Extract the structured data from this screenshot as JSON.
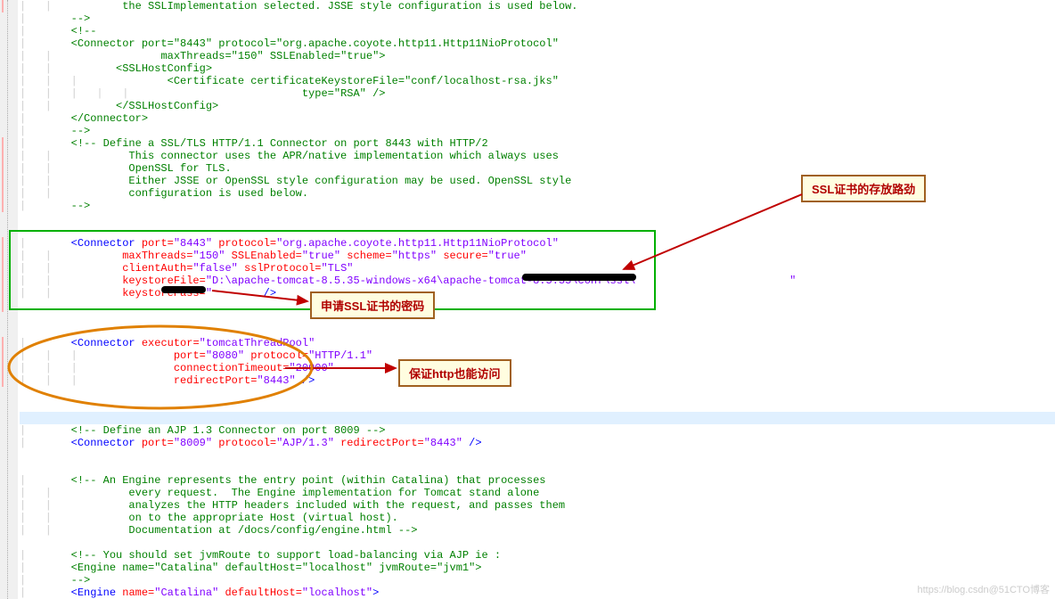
{
  "annotations": {
    "ssl_path": "SSL证书的存放路劲",
    "ssl_password": "申请SSL证书的密码",
    "http_access": "保证http也能访问"
  },
  "code": {
    "l0": "        the SSLImplementation selected. JSSE style configuration is used below.",
    "l1": "    -->",
    "l2": "    <!--",
    "l3": "    <Connector port=\"8443\" protocol=\"org.apache.coyote.http11.Http11NioProtocol\"",
    "l4": "               maxThreads=\"150\" SSLEnabled=\"true\">",
    "l5": "        <SSLHostConfig>",
    "l6": "            <Certificate certificateKeystoreFile=\"conf/localhost-rsa.jks\"",
    "l7": "                         type=\"RSA\" />",
    "l8": "        </SSLHostConfig>",
    "l9": "    </Connector>",
    "l10": "    -->",
    "l11": "    <!-- Define a SSL/TLS HTTP/1.1 Connector on port 8443 with HTTP/2",
    "l12": "         This connector uses the APR/native implementation which always uses",
    "l13": "         OpenSSL for TLS.",
    "l14": "         Either JSSE or OpenSSL style configuration may be used. OpenSSL style",
    "l15": "         configuration is used below.",
    "l16": "    -->",
    "c1_open": "<Connector",
    "c1_port_k": " port=",
    "c1_port_v": "\"8443\"",
    "c1_proto_k": " protocol=",
    "c1_proto_v": "\"org.apache.coyote.http11.Http11NioProtocol\"",
    "c1_mt_k": "maxThreads=",
    "c1_mt_v": "\"150\"",
    "c1_ssl_k": " SSLEnabled=",
    "c1_ssl_v": "\"true\"",
    "c1_sch_k": " scheme=",
    "c1_sch_v": "\"https\"",
    "c1_sec_k": " secure=",
    "c1_sec_v": "\"true\"",
    "c1_ca_k": "clientAuth=",
    "c1_ca_v": "\"false\"",
    "c1_sp_k": " sslProtocol=",
    "c1_sp_v": "\"TLS\"",
    "c1_kf_k": "keystoreFile=",
    "c1_kf_v": "\"D:\\apache-tomcat-8.5.35-windows-x64\\apache-tomcat-8.5.35\\conf\\ssl\\",
    "c1_kf_end": "\"",
    "c1_kp_k": "keystorePass=",
    "c1_kp_v": "\"",
    "c1_close": "/>",
    "c2_open": "<Connector",
    "c2_ex_k": " executor=",
    "c2_ex_v": "\"tomcatThreadPool\"",
    "c2_port_k": "port=",
    "c2_port_v": "\"8080\"",
    "c2_proto_k": " protocol=",
    "c2_proto_v": "\"HTTP/1.1\"",
    "c2_ct_k": "connectionTimeout=",
    "c2_ct_v": "\"20000\"",
    "c2_rp_k": "redirectPort=",
    "c2_rp_v": "\"8443\"",
    "c2_close": " />",
    "l30": "    <!-- Define an AJP 1.3 Connector on port 8009 -->",
    "c3_open": "<Connector",
    "c3_port_k": " port=",
    "c3_port_v": "\"8009\"",
    "c3_proto_k": " protocol=",
    "c3_proto_v": "\"AJP/1.3\"",
    "c3_rp_k": " redirectPort=",
    "c3_rp_v": "\"8443\"",
    "c3_close": " />",
    "l34": "    <!-- An Engine represents the entry point (within Catalina) that processes",
    "l35": "         every request.  The Engine implementation for Tomcat stand alone",
    "l36": "         analyzes the HTTP headers included with the request, and passes them",
    "l37": "         on to the appropriate Host (virtual host).",
    "l38": "         Documentation at /docs/config/engine.html -->",
    "l40": "    <!-- You should set jvmRoute to support load-balancing via AJP ie :",
    "l41": "    <Engine name=\"Catalina\" defaultHost=\"localhost\" jvmRoute=\"jvm1\">",
    "l42": "    -->",
    "e_open": "<Engine",
    "e_name_k": " name=",
    "e_name_v": "\"Catalina\"",
    "e_dh_k": " defaultHost=",
    "e_dh_v": "\"localhost\"",
    "e_close": ">"
  },
  "watermark": "https://blog.csdn@51CTO博客"
}
